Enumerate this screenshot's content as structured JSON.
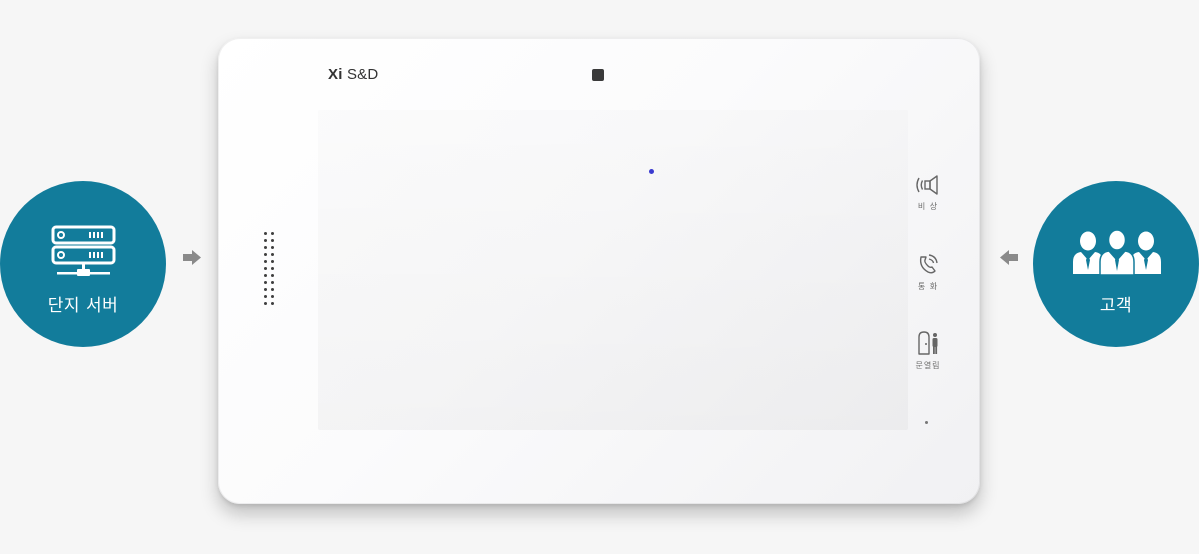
{
  "left_node": {
    "label": "단지 서버",
    "icon": "server-rack-icon"
  },
  "right_node": {
    "label": "고객",
    "icon": "users-group-icon"
  },
  "device": {
    "brand_bold": "Xi",
    "brand_rest": " S&D",
    "buttons": [
      {
        "label": "비 상",
        "icon": "emergency-speaker-icon"
      },
      {
        "label": "통 화",
        "icon": "call-icon"
      },
      {
        "label": "문열림",
        "icon": "door-open-icon"
      }
    ]
  },
  "colors": {
    "circle": "#127c9b",
    "arrow": "#8a8a8a",
    "led": "#3a3ad0"
  }
}
